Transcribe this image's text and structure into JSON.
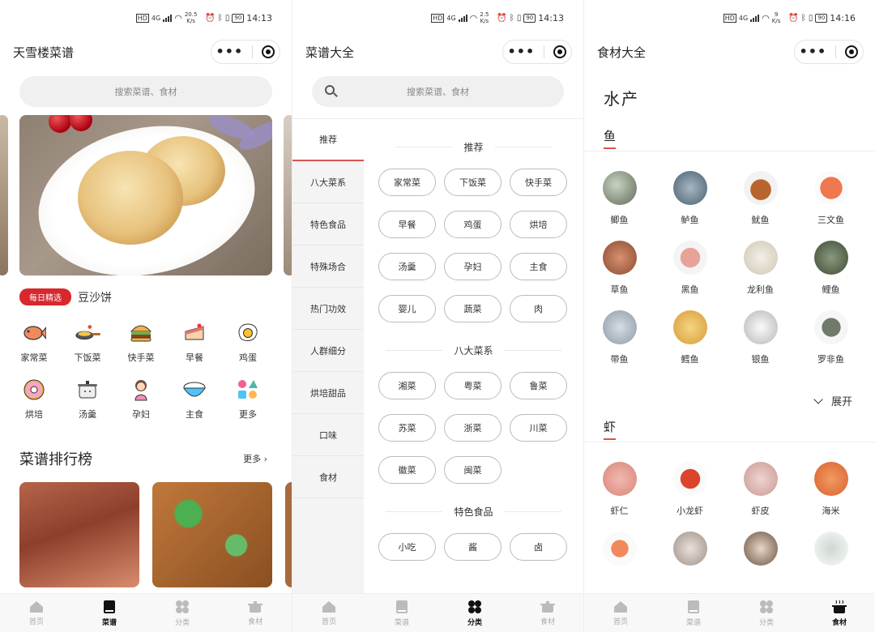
{
  "screens": [
    {
      "status": {
        "hd": "HD",
        "net": "4G",
        "speed_value": "20.5",
        "speed_unit": "K/s",
        "battery": "90",
        "time": "14:13"
      },
      "header_title": "天雪楼菜谱",
      "search_placeholder": "搜索菜谱、食材"
    },
    {
      "status": {
        "hd": "HD",
        "net": "4G",
        "speed_value": "2.5",
        "speed_unit": "K/s",
        "battery": "90",
        "time": "14:13"
      },
      "header_title": "菜谱大全",
      "search_placeholder": "搜索菜谱、食材"
    },
    {
      "status": {
        "hd": "HD",
        "net": "4G",
        "speed_value": "9",
        "speed_unit": "K/s",
        "battery": "90",
        "time": "14:16"
      },
      "header_title": "食材大全"
    }
  ],
  "home": {
    "daily_badge": "每日精选",
    "daily_name": "豆沙饼",
    "categories": [
      {
        "label": "家常菜",
        "icon": "fish-icon"
      },
      {
        "label": "下饭菜",
        "icon": "frying-pan-icon"
      },
      {
        "label": "快手菜",
        "icon": "burger-icon"
      },
      {
        "label": "早餐",
        "icon": "cake-slice-icon"
      },
      {
        "label": "鸡蛋",
        "icon": "fried-egg-icon"
      },
      {
        "label": "烘培",
        "icon": "donut-icon"
      },
      {
        "label": "汤羹",
        "icon": "pot-icon"
      },
      {
        "label": "孕妇",
        "icon": "pregnant-woman-icon"
      },
      {
        "label": "主食",
        "icon": "rice-bowl-icon"
      },
      {
        "label": "更多",
        "icon": "shapes-icon"
      }
    ],
    "ranking_title": "菜谱排行榜",
    "ranking_more": "更多 ›"
  },
  "category_page": {
    "sidenav": [
      "推荐",
      "八大菜系",
      "特色食品",
      "特殊场合",
      "热门功效",
      "人群细分",
      "烘培甜品",
      "口味",
      "食材"
    ],
    "active_index": 0,
    "sections": [
      {
        "title": "推荐",
        "chips": [
          "家常菜",
          "下饭菜",
          "快手菜",
          "早餐",
          "鸡蛋",
          "烘培",
          "汤羹",
          "孕妇",
          "主食",
          "婴儿",
          "蔬菜",
          "肉"
        ]
      },
      {
        "title": "八大菜系",
        "chips": [
          "湘菜",
          "粤菜",
          "鲁菜",
          "苏菜",
          "浙菜",
          "川菜",
          "徽菜",
          "闽菜"
        ]
      },
      {
        "title": "特色食品",
        "chips": [
          "小吃",
          "酱",
          "卤"
        ]
      }
    ]
  },
  "ingredient_page": {
    "group_title": "水产",
    "fish_tab": "鱼",
    "fish": [
      "鲫鱼",
      "鲈鱼",
      "鱿鱼",
      "三文鱼",
      "草鱼",
      "黑鱼",
      "龙利鱼",
      "鲤鱼",
      "带鱼",
      "鳕鱼",
      "银鱼",
      "罗非鱼"
    ],
    "expand_label": "展开",
    "shrimp_tab": "虾",
    "shrimp": [
      "虾仁",
      "小龙虾",
      "虾皮",
      "海米",
      "",
      "",
      "",
      ""
    ]
  },
  "tabs": [
    "首页",
    "菜谱",
    "分类",
    "食材"
  ],
  "active_tabs": [
    1,
    2,
    3
  ],
  "colors": {
    "accent": "#d6282d",
    "chip_border": "#bbbbbb"
  }
}
